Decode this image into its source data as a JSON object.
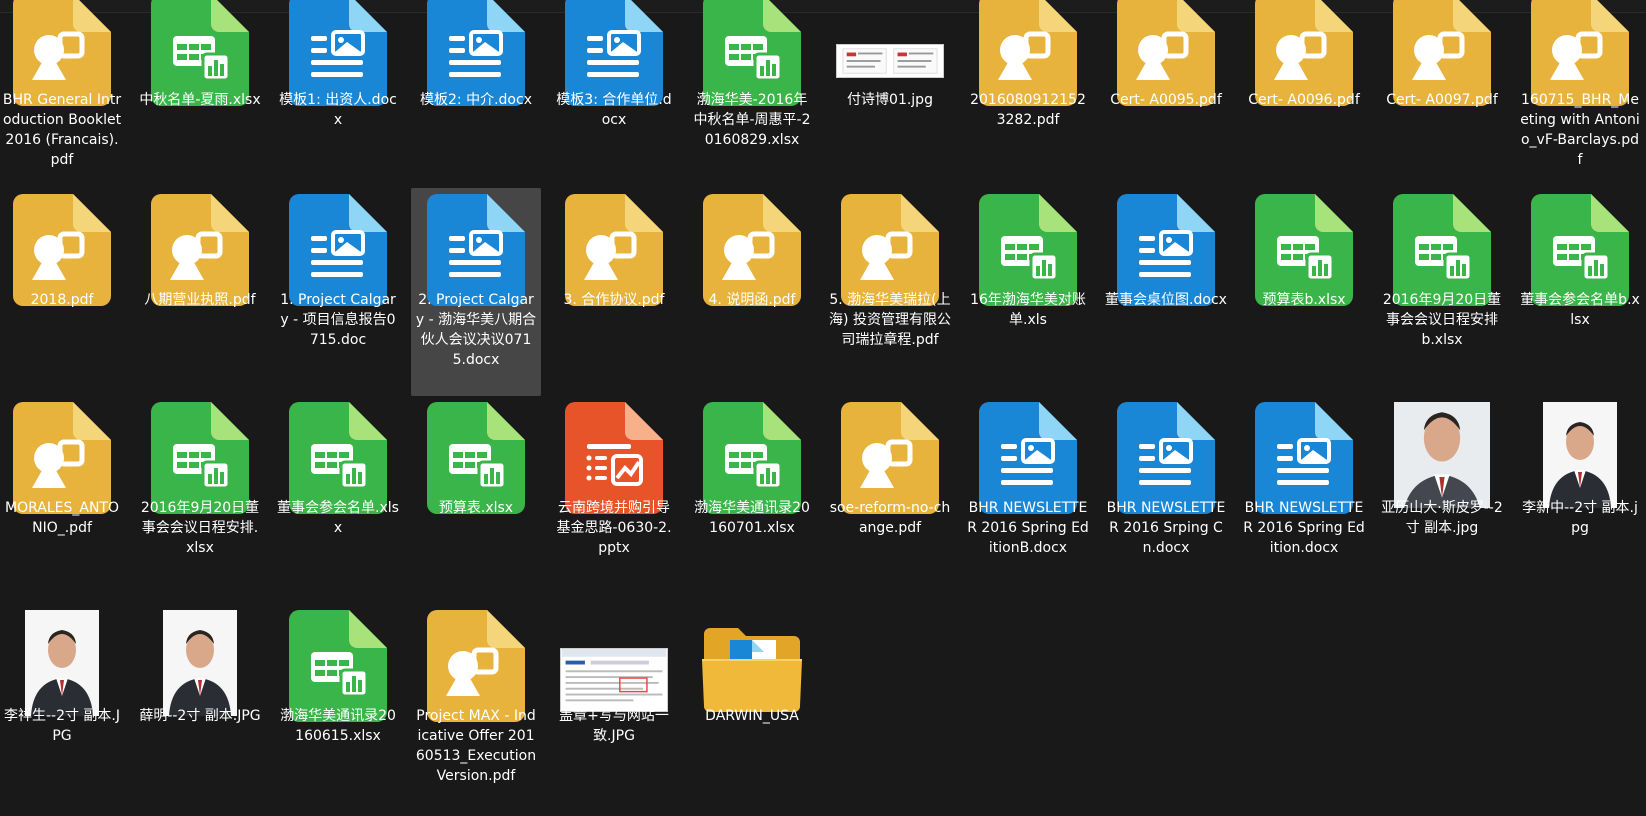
{
  "window": {
    "title": ""
  },
  "colors": {
    "background": "#191919",
    "selection": "#464646",
    "pdf": "#e8b33c",
    "pdf_corner": "#f5d57a",
    "xlsx": "#3ab54a",
    "xlsx_corner": "#a8e27a",
    "docx": "#1a86d6",
    "docx_corner": "#8fd6f6",
    "pptx": "#e8542a",
    "pptx_corner": "#f7b08a",
    "folder": "#f0b93a"
  },
  "files": [
    {
      "name": "BHR General Introduction Booklet 2016 (Francais).pdf",
      "type": "pdf",
      "icon": "pdf-file-icon"
    },
    {
      "name": "中秋名单-夏雨.xlsx",
      "type": "xlsx",
      "icon": "spreadsheet-file-icon"
    },
    {
      "name": "模板1: 出资人.docx",
      "type": "docx",
      "icon": "document-file-icon"
    },
    {
      "name": "模板2: 中介.docx",
      "type": "docx",
      "icon": "document-file-icon"
    },
    {
      "name": "模板3: 合作单位.docx",
      "type": "docx",
      "icon": "document-file-icon"
    },
    {
      "name": "渤海华美-2016年中秋名单-周惠平-20160829.xlsx",
      "type": "xlsx",
      "icon": "spreadsheet-file-icon"
    },
    {
      "name": "付诗博01.jpg",
      "type": "jpg-card",
      "icon": "image-thumbnail-icon"
    },
    {
      "name": "20160809121523282.pdf",
      "type": "pdf",
      "icon": "pdf-file-icon"
    },
    {
      "name": "Cert- A0095.pdf",
      "type": "pdf",
      "icon": "pdf-file-icon"
    },
    {
      "name": "Cert- A0096.pdf",
      "type": "pdf",
      "icon": "pdf-file-icon"
    },
    {
      "name": "Cert- A0097.pdf",
      "type": "pdf",
      "icon": "pdf-file-icon"
    },
    {
      "name": "160715_BHR_Meeting with Antonio_vF-Barclays.pdf",
      "type": "pdf",
      "icon": "pdf-file-icon"
    },
    {
      "name": "2018.pdf",
      "type": "pdf",
      "icon": "pdf-file-icon"
    },
    {
      "name": "八期营业执照.pdf",
      "type": "pdf",
      "icon": "pdf-file-icon"
    },
    {
      "name": "1. Project Calgary - 项目信息报告0715.doc",
      "type": "docx",
      "icon": "document-file-icon"
    },
    {
      "name": "2. Project Calgary - 渤海华美八期合伙人会议决议0715.docx",
      "type": "docx",
      "icon": "document-file-icon",
      "selected": true
    },
    {
      "name": "3. 合作协议.pdf",
      "type": "pdf",
      "icon": "pdf-file-icon"
    },
    {
      "name": "4. 说明函.pdf",
      "type": "pdf",
      "icon": "pdf-file-icon"
    },
    {
      "name": "5. 渤海华美瑞拉(上海) 投资管理有限公司瑞拉章程.pdf",
      "type": "pdf",
      "icon": "pdf-file-icon"
    },
    {
      "name": "16年渤海华美对账单.xls",
      "type": "xlsx",
      "icon": "spreadsheet-file-icon"
    },
    {
      "name": "董事会桌位图.docx",
      "type": "docx",
      "icon": "document-file-icon"
    },
    {
      "name": "预算表b.xlsx",
      "type": "xlsx",
      "icon": "spreadsheet-file-icon"
    },
    {
      "name": "2016年9月20日董事会会议日程安排b.xlsx",
      "type": "xlsx",
      "icon": "spreadsheet-file-icon"
    },
    {
      "name": "董事会参会名单b.xlsx",
      "type": "xlsx",
      "icon": "spreadsheet-file-icon"
    },
    {
      "name": "MORALES_ANTONIO_.pdf",
      "type": "pdf",
      "icon": "pdf-file-icon"
    },
    {
      "name": "2016年9月20日董事会会议日程安排.xlsx",
      "type": "xlsx",
      "icon": "spreadsheet-file-icon"
    },
    {
      "name": "董事会参会名单.xlsx",
      "type": "xlsx",
      "icon": "spreadsheet-file-icon"
    },
    {
      "name": "预算表.xlsx",
      "type": "xlsx",
      "icon": "spreadsheet-file-icon"
    },
    {
      "name": "云南跨境并购引导基金思路-0630-2.pptx",
      "type": "pptx",
      "icon": "presentation-file-icon"
    },
    {
      "name": "渤海华美通讯录20160701.xlsx",
      "type": "xlsx",
      "icon": "spreadsheet-file-icon"
    },
    {
      "name": "soe-reform-no-change.pdf",
      "type": "pdf",
      "icon": "pdf-file-icon"
    },
    {
      "name": "BHR NEWSLETTER 2016 Spring EditionB.docx",
      "type": "docx",
      "icon": "document-file-icon"
    },
    {
      "name": "BHR NEWSLETTER 2016 Srping Cn.docx",
      "type": "docx",
      "icon": "document-file-icon"
    },
    {
      "name": "BHR NEWSLETTER 2016 Spring Edition.docx",
      "type": "docx",
      "icon": "document-file-icon"
    },
    {
      "name": "亚历山大·斯皮罗--2寸 副本.jpg",
      "type": "photo-wide",
      "icon": "portrait-photo-icon"
    },
    {
      "name": "李新中--2寸 副本.jpg",
      "type": "photo",
      "icon": "portrait-photo-icon"
    },
    {
      "name": "李祥生--2寸 副本.JPG",
      "type": "photo",
      "icon": "portrait-photo-icon"
    },
    {
      "name": "薛明--2寸 副本.JPG",
      "type": "photo",
      "icon": "portrait-photo-icon"
    },
    {
      "name": "渤海华美通讯录20160615.xlsx",
      "type": "xlsx",
      "icon": "spreadsheet-file-icon"
    },
    {
      "name": "Project MAX - Indicative Offer 20160513_Execution Version.pdf",
      "type": "pdf",
      "icon": "pdf-file-icon"
    },
    {
      "name": "盖章+写与网站一致.JPG",
      "type": "jpg-screen",
      "icon": "screenshot-thumbnail-icon"
    },
    {
      "name": "DARWIN_USA",
      "type": "folder",
      "icon": "folder-icon"
    }
  ]
}
